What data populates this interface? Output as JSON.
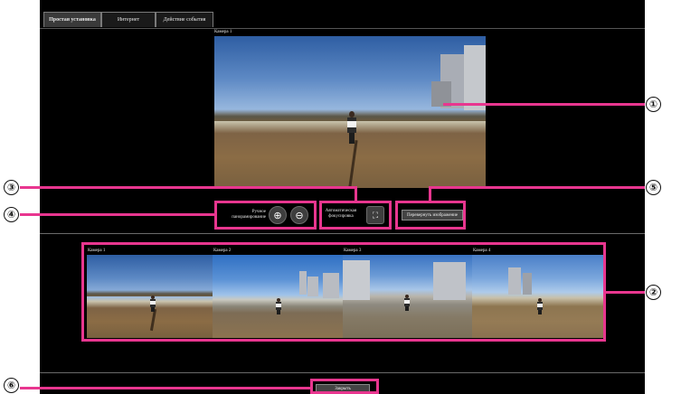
{
  "tabs": [
    {
      "label": "Простая установка",
      "active": true
    },
    {
      "label": "Интернет",
      "active": false
    },
    {
      "label": "Действие события",
      "active": false
    }
  ],
  "main_preview": {
    "camera_label": "Камера 1"
  },
  "controls": {
    "manual_pan_label": "Ручное панорамирование",
    "zoom_in_icon": "zoom-in-icon",
    "zoom_out_icon": "zoom-out-icon",
    "autofocus_label": "Автоматическая фокусировка",
    "autofocus_icon": "autofocus-icon",
    "reverse_image_label": "Перевернуть изображение"
  },
  "thumbnails": [
    {
      "label": "Камера 1"
    },
    {
      "label": "Камера 2"
    },
    {
      "label": "Камера 3"
    },
    {
      "label": "Камера 4"
    }
  ],
  "close_label": "Закрыть",
  "callouts": [
    "①",
    "②",
    "③",
    "④",
    "⑤",
    "⑥"
  ],
  "colors": {
    "highlight": "#e8368f",
    "background": "#000000"
  }
}
